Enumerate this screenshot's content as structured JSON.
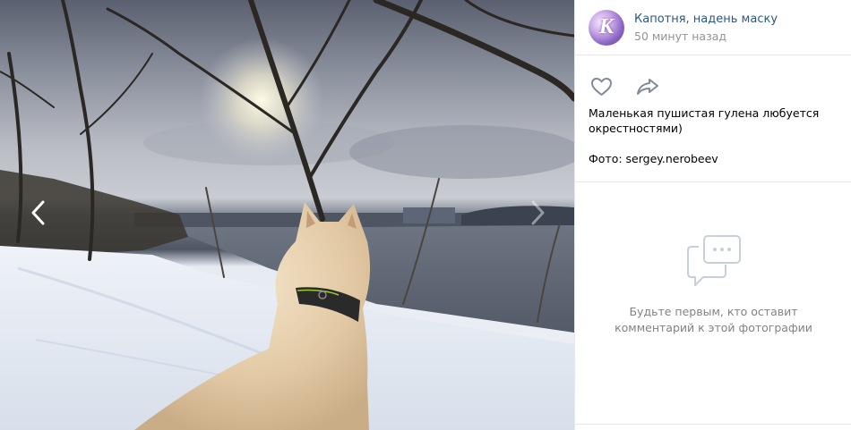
{
  "post": {
    "author_name": "Капотня, надень маску",
    "time": "50 минут назад",
    "avatar_letter": "К",
    "description_line": "Маленькая пушистая гулена любуется окрестностями)",
    "photo_credit": "Фото: sergey.nerobeev"
  },
  "actions": {
    "like_icon": "heart-icon",
    "share_icon": "share-arrow-icon"
  },
  "comments": {
    "empty_line1": "Будьте первым, кто оставит",
    "empty_line2": "комментарий к этой фотографии",
    "empty_icon": "chat-bubble-icon"
  },
  "photo": {
    "prev_icon": "chevron-left-icon",
    "next_icon": "chevron-right-icon"
  }
}
